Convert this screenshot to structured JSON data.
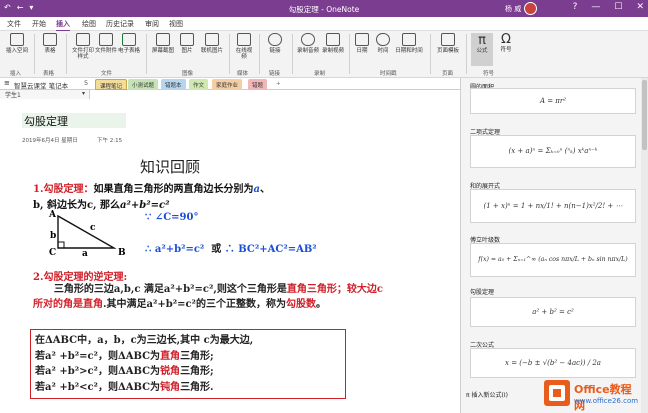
{
  "window": {
    "title": "勾股定理 - OneNote",
    "user": "杨 威",
    "controls": [
      "?",
      "—",
      "☐",
      "✕"
    ],
    "qa": [
      "↶",
      "←",
      "▾"
    ]
  },
  "tabs": [
    "文件",
    "开始",
    "插入",
    "绘图",
    "历史记录",
    "审阅",
    "视图"
  ],
  "ribbon": {
    "buttons": [
      "插入空间",
      "表格",
      "文件打印样式",
      "文件附件",
      "电子表格",
      "屏幕截图",
      "图片",
      "联机图片",
      "在线视频",
      "链接",
      "录制音频",
      "录制视频",
      "日期",
      "时间",
      "日期和时间",
      "页面模板",
      "公式",
      "符号"
    ],
    "groups": [
      "插入",
      "表格",
      "文件",
      "图像",
      "媒体",
      "链接",
      "录制",
      "时间戳",
      "页面",
      "符号"
    ]
  },
  "notebook": {
    "name": "智慧云课堂 笔记本",
    "count": "5",
    "sections": [
      "课程笔记",
      "小测试题",
      "错题本",
      "作文",
      "家庭作业",
      "错题",
      "+"
    ],
    "user": "学生1"
  },
  "page": {
    "title": "勾股定理",
    "date": "2019年6月4日 星期日",
    "time": "下午 2:15",
    "heading": "知识回顾",
    "def_label": "1.勾股定理：",
    "def_text1": "如果直角三角形的两直角边长分别为",
    "def_a": "a",
    "def_sep": "、",
    "def_text2": "b, 斜边长为c, 那么",
    "def_formula": "a²+b²=c²",
    ".": ".",
    "tri_A": "A",
    "tri_B": "B",
    "tri_C": "C",
    "tri_a": "a",
    "tri_b": "b",
    "tri_c": "c",
    "angle": "∵ ∠C=90°",
    "eq_l": "∴ a²+b²=c²",
    "eq_or": "或",
    "eq_r": "∴ BC²+AC²=AB²",
    "converse_head": "2.勾股定理的逆定理:",
    "converse_p1": "三角形的三边a,b,c 满足a²+b²=c²,则这个三角形是",
    "converse_red1": "直角三角形",
    "converse_p2": "；较大边c 所对的角是直角",
    "converse_p3": ".其中满足a²+b²=c²的三个正整数，称为",
    "converse_red2": "勾股数",
    "converse_end": "。",
    "box_line1": "在ΔABC中，a，b，c为三边长,其中 c为最大边,",
    "box_l2a": "若a² +b²=c²，则ΔABC为",
    "box_l2b": "直角",
    "box_l2c": "三角形;",
    "box_l3a": "若a² +b²>c²，则ΔABC为",
    "box_l3b": "锐角",
    "box_l3c": "三角形;",
    "box_l4a": "若a² +b²<c²，则ΔABC为",
    "box_l4b": "钝角",
    "box_l4c": "三角形."
  },
  "panel": {
    "items": [
      {
        "name": "圆的面积",
        "formula": "A = πr²"
      },
      {
        "name": "二项式定理",
        "formula": "(x + a)ⁿ = Σₖ₌₀ⁿ (ⁿₖ) xᵏaⁿ⁻ᵏ"
      },
      {
        "name": "和的展开式",
        "formula": "(1 + x)ⁿ = 1 + nx/1! + n(n−1)x²/2! + ⋯"
      },
      {
        "name": "傅立叶级数",
        "formula": "f(x) = a₀ + Σₙ₌₁^∞ (aₙ cos nπx/L + bₙ sin nπx/L)"
      },
      {
        "name": "勾股定理",
        "formula": "a² + b² = c²"
      },
      {
        "name": "二次公式",
        "formula": "x = (−b ± √(b² − 4ac)) / 2a"
      }
    ],
    "insert_label": "π 插入新公式(I)"
  },
  "watermark": {
    "brand": "Office教程网",
    "url": "www.office26.com"
  },
  "colors": {
    "accent": "#7b3d8f",
    "red": "#d0202a",
    "blue": "#1a4fd4"
  }
}
